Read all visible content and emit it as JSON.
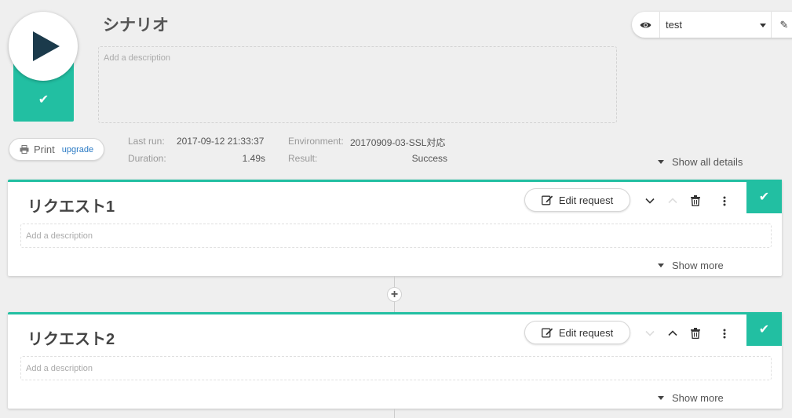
{
  "scenario": {
    "title": "シナリオ",
    "description_placeholder": "Add a description",
    "status": "success"
  },
  "environment": {
    "selected": "test"
  },
  "print": {
    "label": "Print",
    "upgrade_label": "upgrade"
  },
  "run_info": {
    "last_run_label": "Last run:",
    "last_run_value": "2017-09-12 21:33:37",
    "duration_label": "Duration:",
    "duration_value": "1.49s",
    "environment_label": "Environment:",
    "environment_value": "20170909-03-SSL対応",
    "result_label": "Result:",
    "result_value": "Success",
    "show_all_label": "Show all details"
  },
  "requests": [
    {
      "title": "リクエスト1",
      "description_placeholder": "Add a description",
      "edit_label": "Edit request",
      "show_more_label": "Show more",
      "status": "success"
    },
    {
      "title": "リクエスト2",
      "description_placeholder": "Add a description",
      "edit_label": "Edit request",
      "show_more_label": "Show more",
      "status": "success"
    }
  ],
  "icons": {
    "run": "play-icon",
    "env": "eye-icon",
    "env_edit": "pencil-icon",
    "print": "printer-icon",
    "edit": "edit-icon",
    "move_down": "chevron-down-icon",
    "move_up": "chevron-up-icon",
    "delete": "trash-icon",
    "menu": "more-vertical-icon",
    "status": "check-icon",
    "add": "plus-icon"
  },
  "colors": {
    "accent": "#22bfa2",
    "play": "#1b3a4b",
    "link": "#2a7ac4"
  }
}
